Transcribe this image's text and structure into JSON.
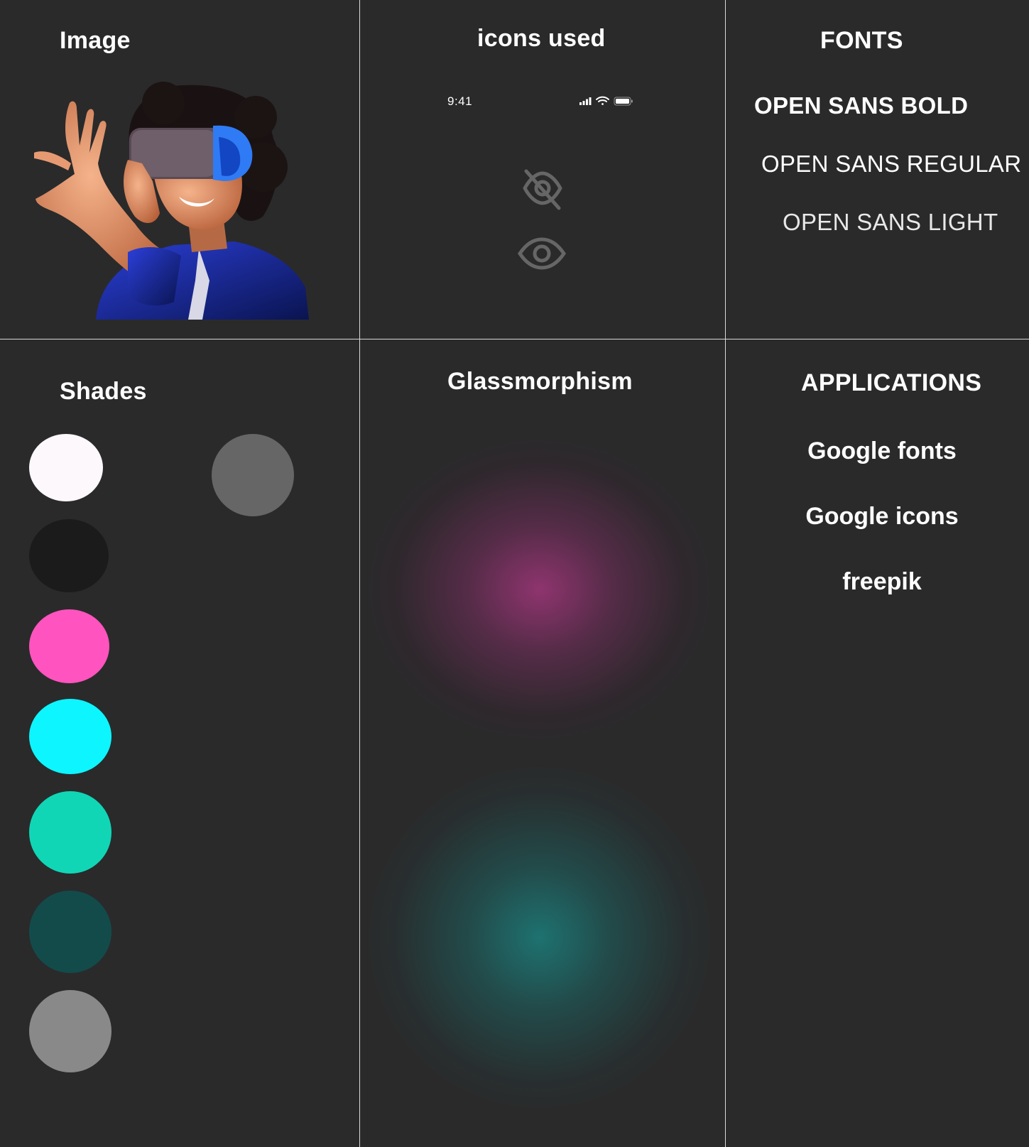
{
  "panels": {
    "image": {
      "title": "Image"
    },
    "icons": {
      "title": "icons used",
      "status_time": "9:41",
      "icons": [
        "signal-icon",
        "wifi-icon",
        "battery-icon",
        "eye-off-icon",
        "eye-icon"
      ]
    },
    "fonts": {
      "title": "FONTS",
      "samples": [
        "OPEN SANS BOLD",
        "OPEN SANS REGULAR",
        "OPEN SANS LIGHT"
      ]
    },
    "shades": {
      "title": "Shades",
      "colors": [
        "#fdf8fc",
        "#1b1b1c",
        "#ff54bf",
        "#0df5ff",
        "#10d6b6",
        "#134b4b",
        "#8a898a",
        "#666666"
      ]
    },
    "glass": {
      "title": "Glassmorphism",
      "glow_colors": [
        "#a0367a",
        "#1c7a78"
      ]
    },
    "applications": {
      "title": "APPLICATIONS",
      "items": [
        "Google fonts",
        "Google icons",
        "freepik"
      ]
    }
  },
  "theme": {
    "background": "#2a2a2b",
    "divider": "#d9d9d9"
  }
}
